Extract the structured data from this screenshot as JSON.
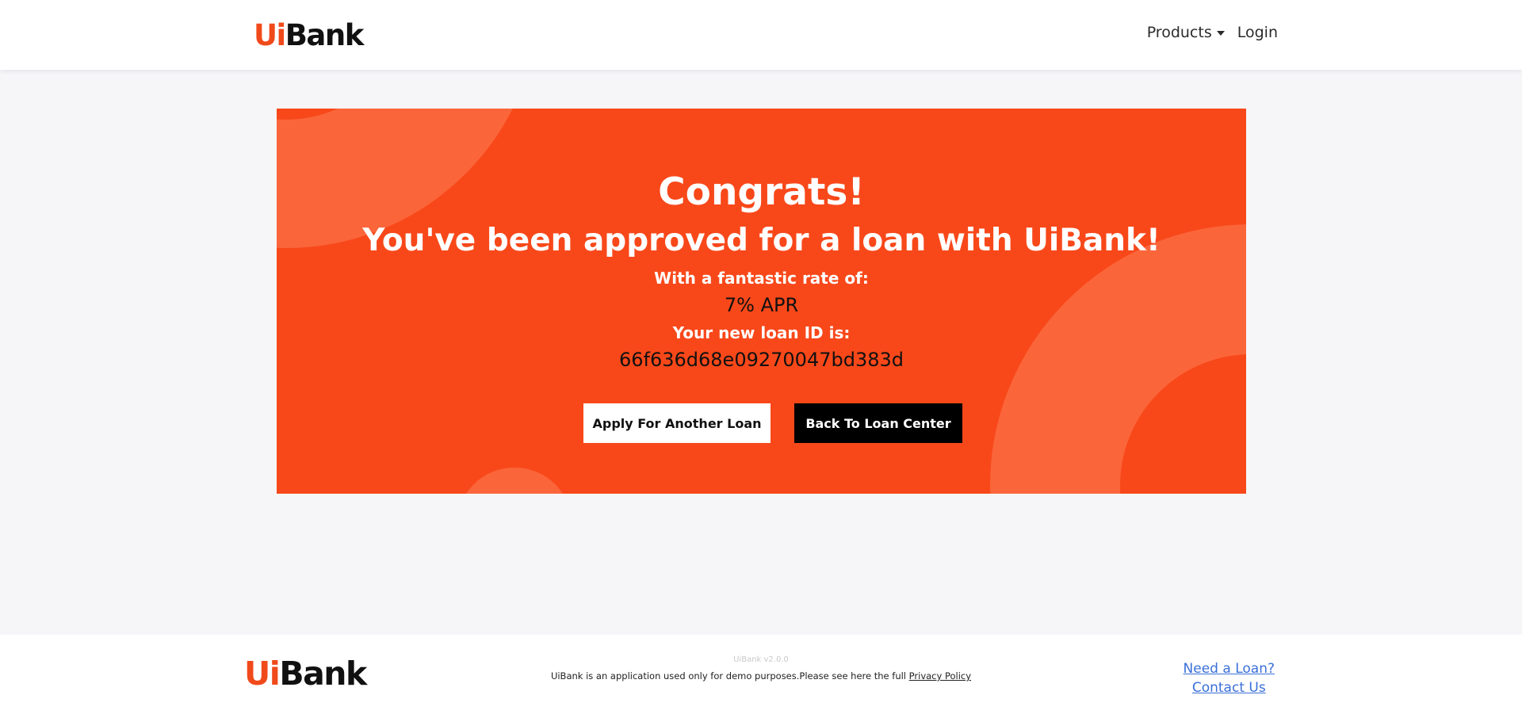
{
  "header": {
    "logo_ui": "Ui",
    "logo_bank": "Bank",
    "products_label": "Products",
    "login_label": "Login"
  },
  "hero": {
    "congrats": "Congrats!",
    "approved": "You've been approved for a loan with UiBank!",
    "rate_label": "With a fantastic rate of:",
    "rate_value": "7% APR",
    "loan_id_label": "Your new loan ID is:",
    "loan_id": "66f636d68e09270047bd383d",
    "apply_button": "Apply For Another Loan",
    "back_button": "Back To Loan Center"
  },
  "footer": {
    "logo_ui": "Ui",
    "logo_bank": "Bank",
    "version": "UiBank v2.0.0",
    "note": "UiBank is an application used only for demo purposes.Please see here the full ",
    "privacy_link": "Privacy Policy",
    "need_loan_link": "Need a Loan?",
    "contact_link": "Contact Us"
  },
  "colors": {
    "brand_orange": "#f8481a",
    "logo_orange": "#f04a1b",
    "page_background": "#f6f6f9",
    "link_blue": "#3a6fd8"
  }
}
